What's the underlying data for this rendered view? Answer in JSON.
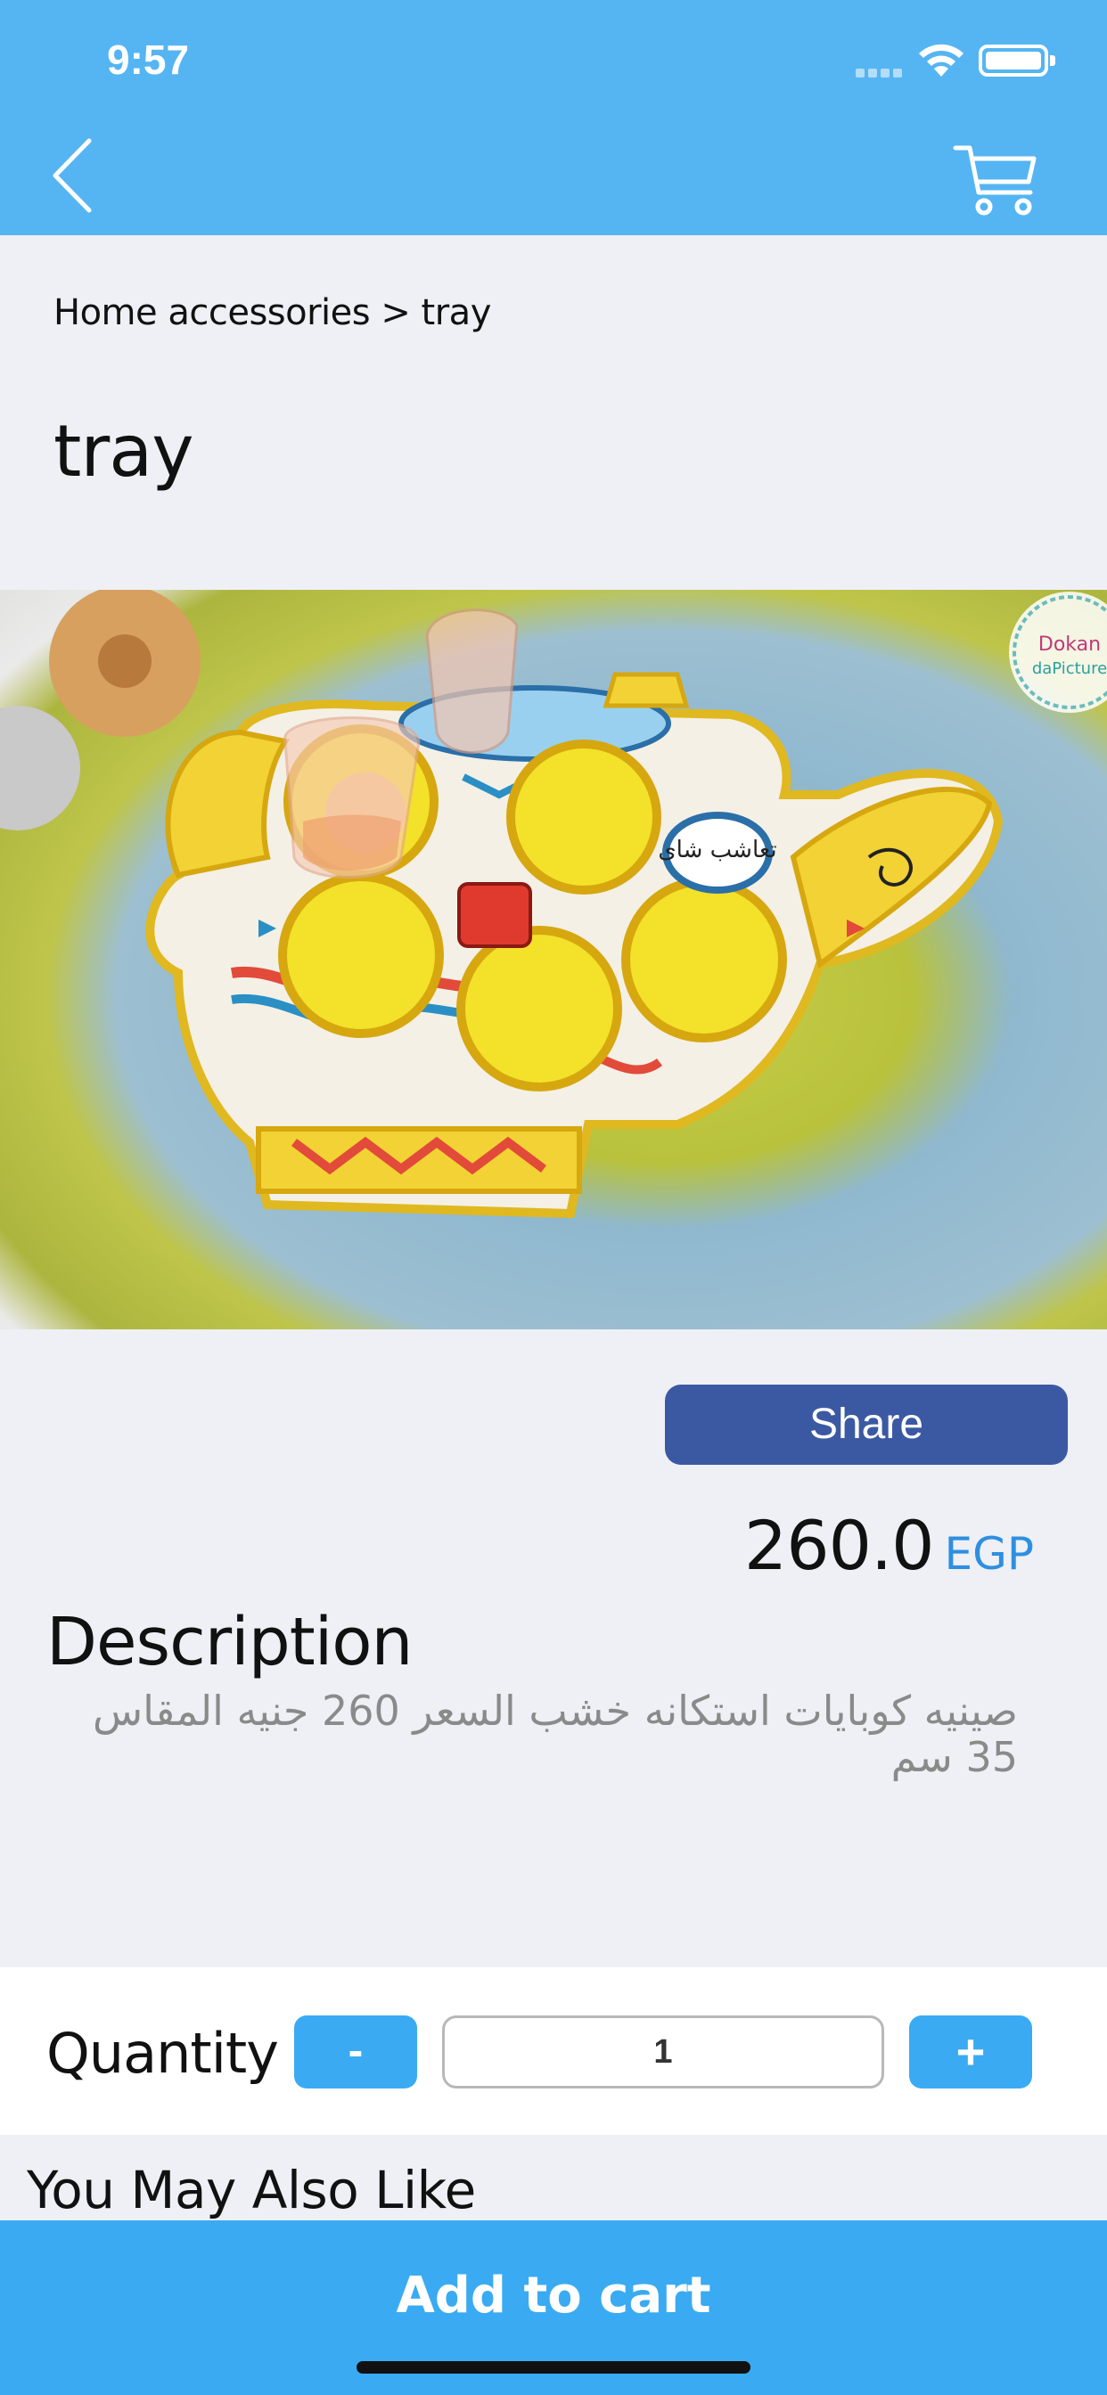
{
  "status_bar": {
    "time": "9:57"
  },
  "breadcrumb": {
    "text": "Home accessories > tray"
  },
  "product": {
    "title": "tray",
    "image_alt": "teapot shaped tray",
    "watermark": "Dokan daPicture",
    "tray_arabic_text": "تعاشب شاى",
    "share_label": "Share",
    "price_value": "260.0",
    "price_currency": "EGP",
    "description_title": "Description",
    "description_text": "صينيه كوبايات استكانه خشب السعر 260 جنيه المقاس 35 سم"
  },
  "quantity": {
    "label": "Quantity",
    "minus_label": "-",
    "value": "1",
    "plus_label": "+"
  },
  "recommendations": {
    "title": "You May Also Like"
  },
  "cart_bar": {
    "label": "Add to cart"
  },
  "colors": {
    "header": "#55b5f2",
    "share": "#3b59a3",
    "accent": "#3aabf2",
    "currency": "#2e8fe0"
  }
}
